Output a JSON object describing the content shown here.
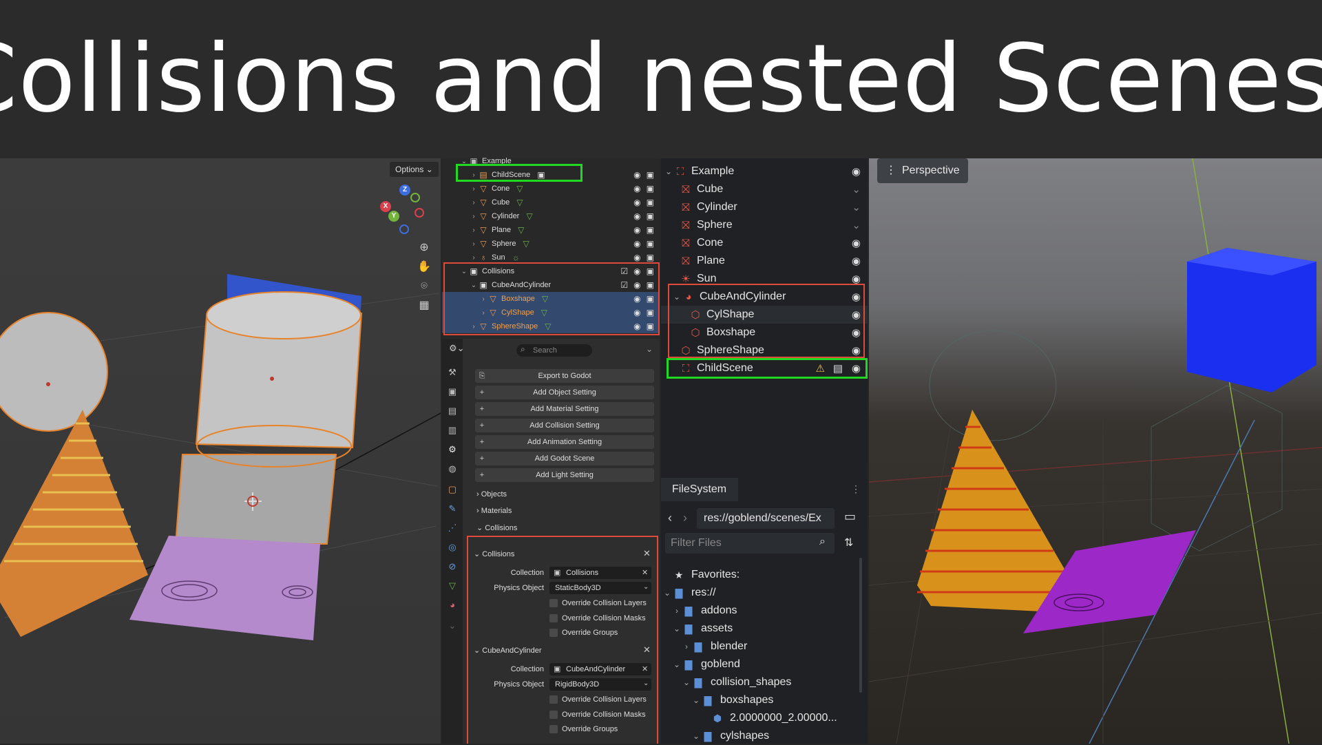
{
  "banner": {
    "title": "Collisions and nested Scenes!"
  },
  "blender": {
    "viewport": {
      "options_label": "Options ⌄"
    },
    "gizmo": {
      "z": "Z",
      "x": "X",
      "y": "Y"
    },
    "outliner": {
      "rows": [
        {
          "label": "Example"
        },
        {
          "label": "ChildScene"
        },
        {
          "label": "Cone"
        },
        {
          "label": "Cube"
        },
        {
          "label": "Cylinder"
        },
        {
          "label": "Plane"
        },
        {
          "label": "Sphere"
        },
        {
          "label": "Sun"
        },
        {
          "label": "Collisions"
        },
        {
          "label": "CubeAndCylinder"
        },
        {
          "label": "Boxshape"
        },
        {
          "label": "CylShape"
        },
        {
          "label": "SphereShape"
        }
      ]
    },
    "properties": {
      "search_placeholder": "Search",
      "buttons": {
        "export": "Export to Godot",
        "add_object": "Add Object Setting",
        "add_material": "Add Material Setting",
        "add_collision": "Add Collision Setting",
        "add_animation": "Add Animation Setting",
        "add_godot_scene": "Add Godot Scene",
        "add_light": "Add Light Setting"
      },
      "sections": {
        "objects": "Objects",
        "materials": "Materials",
        "collisions": "Collisions"
      },
      "collision_panels": [
        {
          "title": "Collisions",
          "collection_label": "Collection",
          "collection_value": "Collisions",
          "physics_label": "Physics Object",
          "physics_value": "StaticBody3D",
          "override_layers": "Override Collision Layers",
          "override_masks": "Override Collision Masks",
          "override_groups": "Override Groups"
        },
        {
          "title": "CubeAndCylinder",
          "collection_label": "Collection",
          "collection_value": "CubeAndCylinder",
          "physics_label": "Physics Object",
          "physics_value": "RigidBody3D",
          "override_layers": "Override Collision Layers",
          "override_masks": "Override Collision Masks",
          "override_groups": "Override Groups"
        }
      ]
    }
  },
  "godot": {
    "scene_tree": {
      "nodes": [
        {
          "label": "Example"
        },
        {
          "label": "Cube"
        },
        {
          "label": "Cylinder"
        },
        {
          "label": "Sphere"
        },
        {
          "label": "Cone"
        },
        {
          "label": "Plane"
        },
        {
          "label": "Sun"
        },
        {
          "label": "CubeAndCylinder"
        },
        {
          "label": "CylShape"
        },
        {
          "label": "Boxshape"
        },
        {
          "label": "SphereShape"
        },
        {
          "label": "ChildScene"
        }
      ]
    },
    "filesystem": {
      "tab_label": "FileSystem",
      "path": "res://goblend/scenes/Ex",
      "filter_placeholder": "Filter Files",
      "items": [
        {
          "label": "Favorites:"
        },
        {
          "label": "res://"
        },
        {
          "label": "addons"
        },
        {
          "label": "assets"
        },
        {
          "label": "blender"
        },
        {
          "label": "goblend"
        },
        {
          "label": "collision_shapes"
        },
        {
          "label": "boxshapes"
        },
        {
          "label": "2.0000000_2.00000..."
        },
        {
          "label": "cylshapes"
        }
      ]
    },
    "viewport": {
      "perspective_label": "Perspective"
    }
  },
  "colors": {
    "highlight_green": "#22d922",
    "highlight_red": "#e04a3a",
    "selection_blue": "#334a6e"
  }
}
